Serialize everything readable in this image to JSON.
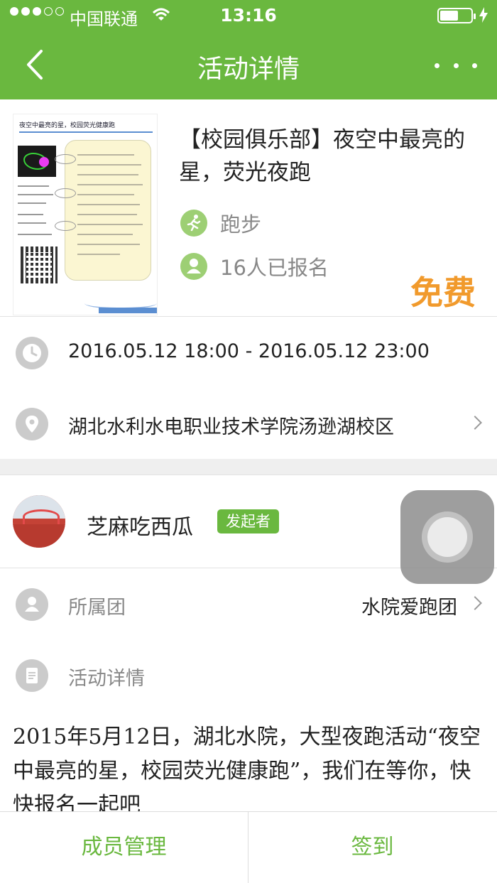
{
  "status_bar": {
    "carrier": "中国联通",
    "time": "13:16"
  },
  "nav": {
    "title": "活动详情"
  },
  "activity": {
    "title": "【校园俱乐部】夜空中最亮的星，荧光夜跑",
    "category": "跑步",
    "signup_count": "16人已报名",
    "price": "免费",
    "poster_caption": "夜空中最亮的星，校园荧光健康跑"
  },
  "info": {
    "time_range": "2016.05.12 18:00 - 2016.05.12 23:00",
    "location": "湖北水利水电职业技术学院汤逊湖校区"
  },
  "organizer": {
    "name": "芝麻吃西瓜",
    "role_badge": "发起者"
  },
  "group": {
    "label": "所属团",
    "value": "水院爱跑团"
  },
  "details": {
    "label": "活动详情",
    "text": "2015年5月12日，湖北水院，大型夜跑活动“夜空中最亮的星，校园荧光健康跑”，我们在等你，快快报名一起吧"
  },
  "tabs": {
    "members": "成员管理",
    "checkin": "签到"
  },
  "colors": {
    "brand_green": "#6ab83f",
    "price_orange": "#f19a2c"
  }
}
